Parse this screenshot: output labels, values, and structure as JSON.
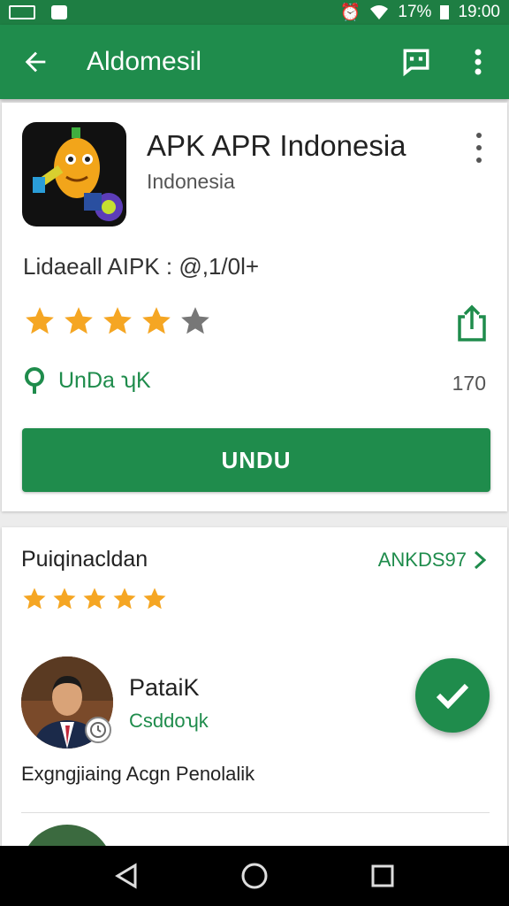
{
  "status_bar": {
    "battery": "17%",
    "time": "19:00"
  },
  "app_bar": {
    "title": "Aldomesil",
    "back_icon": "arrow-left-icon",
    "actions": [
      "message-icon",
      "more-vert-icon"
    ]
  },
  "app": {
    "name": "APK APR Indonesia",
    "publisher": "Indonesia",
    "version_line": "Lidaeall AIPK : @,1/0l+",
    "rating_stars": 4,
    "location_label": "UnDa ʮK",
    "count": "170",
    "install_label": "UNDU"
  },
  "reviews": {
    "title": "Puiqinacldan",
    "link_label": "ANKDS97",
    "rating_stars": 5,
    "items": [
      {
        "name": "PataiK",
        "subtitle": "Csddoʮk",
        "text": "Exgngjiaing Acgn Penolalik"
      }
    ]
  },
  "colors": {
    "primary": "#1f8c4c",
    "status": "#1e7e43",
    "star": "#f5a623",
    "star_empty": "#777777"
  }
}
